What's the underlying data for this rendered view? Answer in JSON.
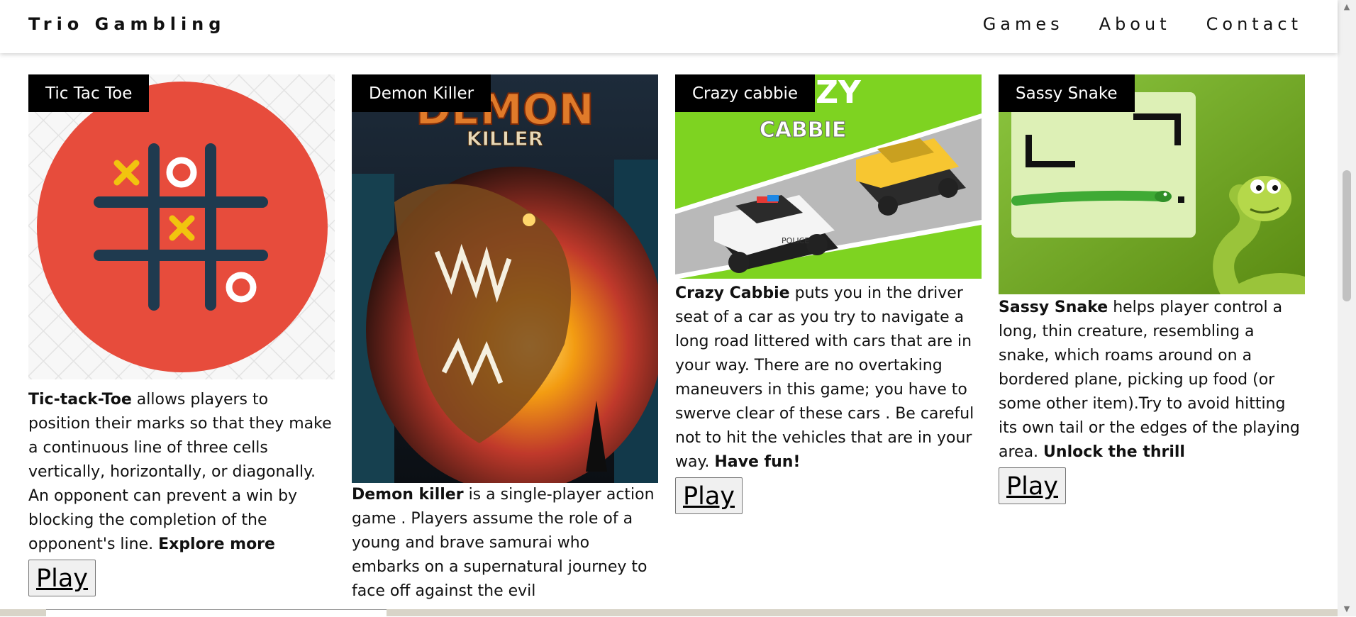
{
  "header": {
    "brand": "Trio Gambling",
    "nav": [
      "Games",
      "About",
      "Contact"
    ]
  },
  "cards": [
    {
      "title": "Tic Tac Toe",
      "lead": "Tic-tack-Toe",
      "body": " allows players to position their marks so that they make a continuous line of three cells vertically, horizontally, or diagonally. An opponent can prevent a win by blocking the completion of the opponent's line. ",
      "tail": "Explore more",
      "play": "Play"
    },
    {
      "title": "Demon Killer",
      "art_text_1": "DEMON",
      "art_text_2": "KILLER",
      "lead": "Demon killer",
      "body": " is a single-player action game . Players assume the role of a young and brave samurai who embarks on a supernatural journey to face off against the evil "
    },
    {
      "title": "Crazy cabbie",
      "art_text_1": "ZY",
      "art_text_2": "CABBIE",
      "art_text_3": "POLICE",
      "lead": "Crazy Cabbie",
      "body": " puts you in the driver seat of a car as you try to navigate a long road littered with cars that are in your way. There are no overtaking maneuvers in this game; you have to swerve clear of these cars . Be careful not to hit the vehicles that are in your way. ",
      "tail": "Have fun!",
      "play": "Play"
    },
    {
      "title": "Sassy Snake",
      "lead": "Sassy Snake",
      "body": " helps player control a long, thin creature, resembling a snake, which roams around on a bordered plane, picking up food (or some other item).Try to avoid hitting its own tail or the edges of the playing area. ",
      "tail": "Unlock the thrill",
      "play": "Play"
    }
  ]
}
